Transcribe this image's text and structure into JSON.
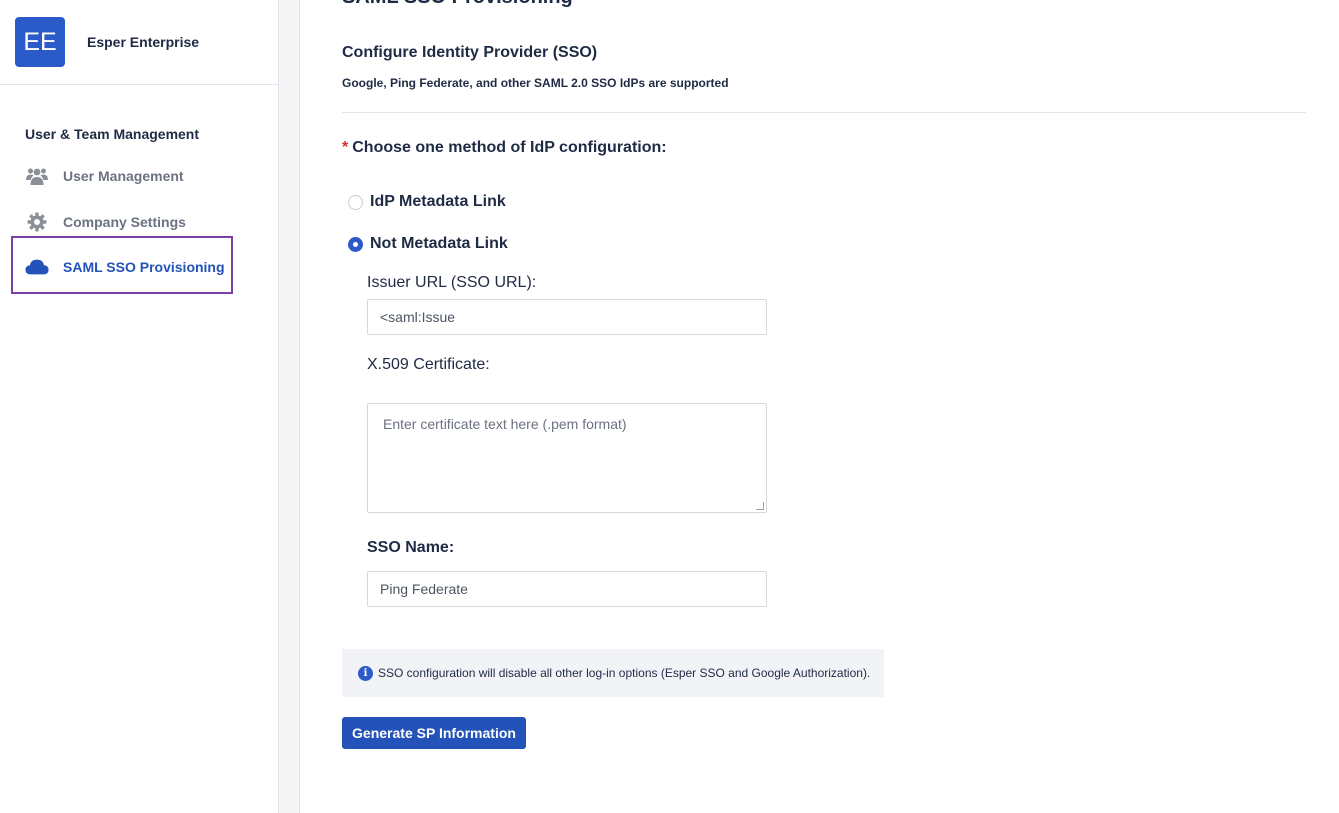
{
  "brand": {
    "logo_text": "EE",
    "name": "Esper Enterprise",
    "color": "#2b5bc8"
  },
  "sidebar": {
    "section_title": "User & Team Management",
    "items": [
      {
        "label": "User Management",
        "icon": "users-icon"
      },
      {
        "label": "Company Settings",
        "icon": "gear-icon"
      },
      {
        "label": "SAML SSO Provisioning",
        "icon": "cloud-icon",
        "active": true
      }
    ]
  },
  "main": {
    "page_title": "SAML SSO Provisioning",
    "section_heading": "Configure Identity Provider (SSO)",
    "section_sub": "Google, Ping Federate, and other SAML 2.0 SSO IdPs are supported",
    "choose_required_mark": "*",
    "choose_label": "Choose one method of IdP configuration:",
    "options": [
      {
        "label": "IdP Metadata Link",
        "checked": false
      },
      {
        "label": "Not Metadata Link",
        "checked": true
      }
    ],
    "issuer_label": "Issuer URL (SSO URL):",
    "issuer_value": "<saml:Issue",
    "cert_label": "X.509 Certificate:",
    "cert_placeholder": "Enter certificate text here (.pem format)",
    "sso_name_label": "SSO Name:",
    "sso_name_value": "Ping Federate",
    "info_text": "SSO configuration will disable all other log-in options (Esper SSO and Google Authorization).",
    "info_icon_glyph": "i",
    "button_label": "Generate SP Information"
  }
}
